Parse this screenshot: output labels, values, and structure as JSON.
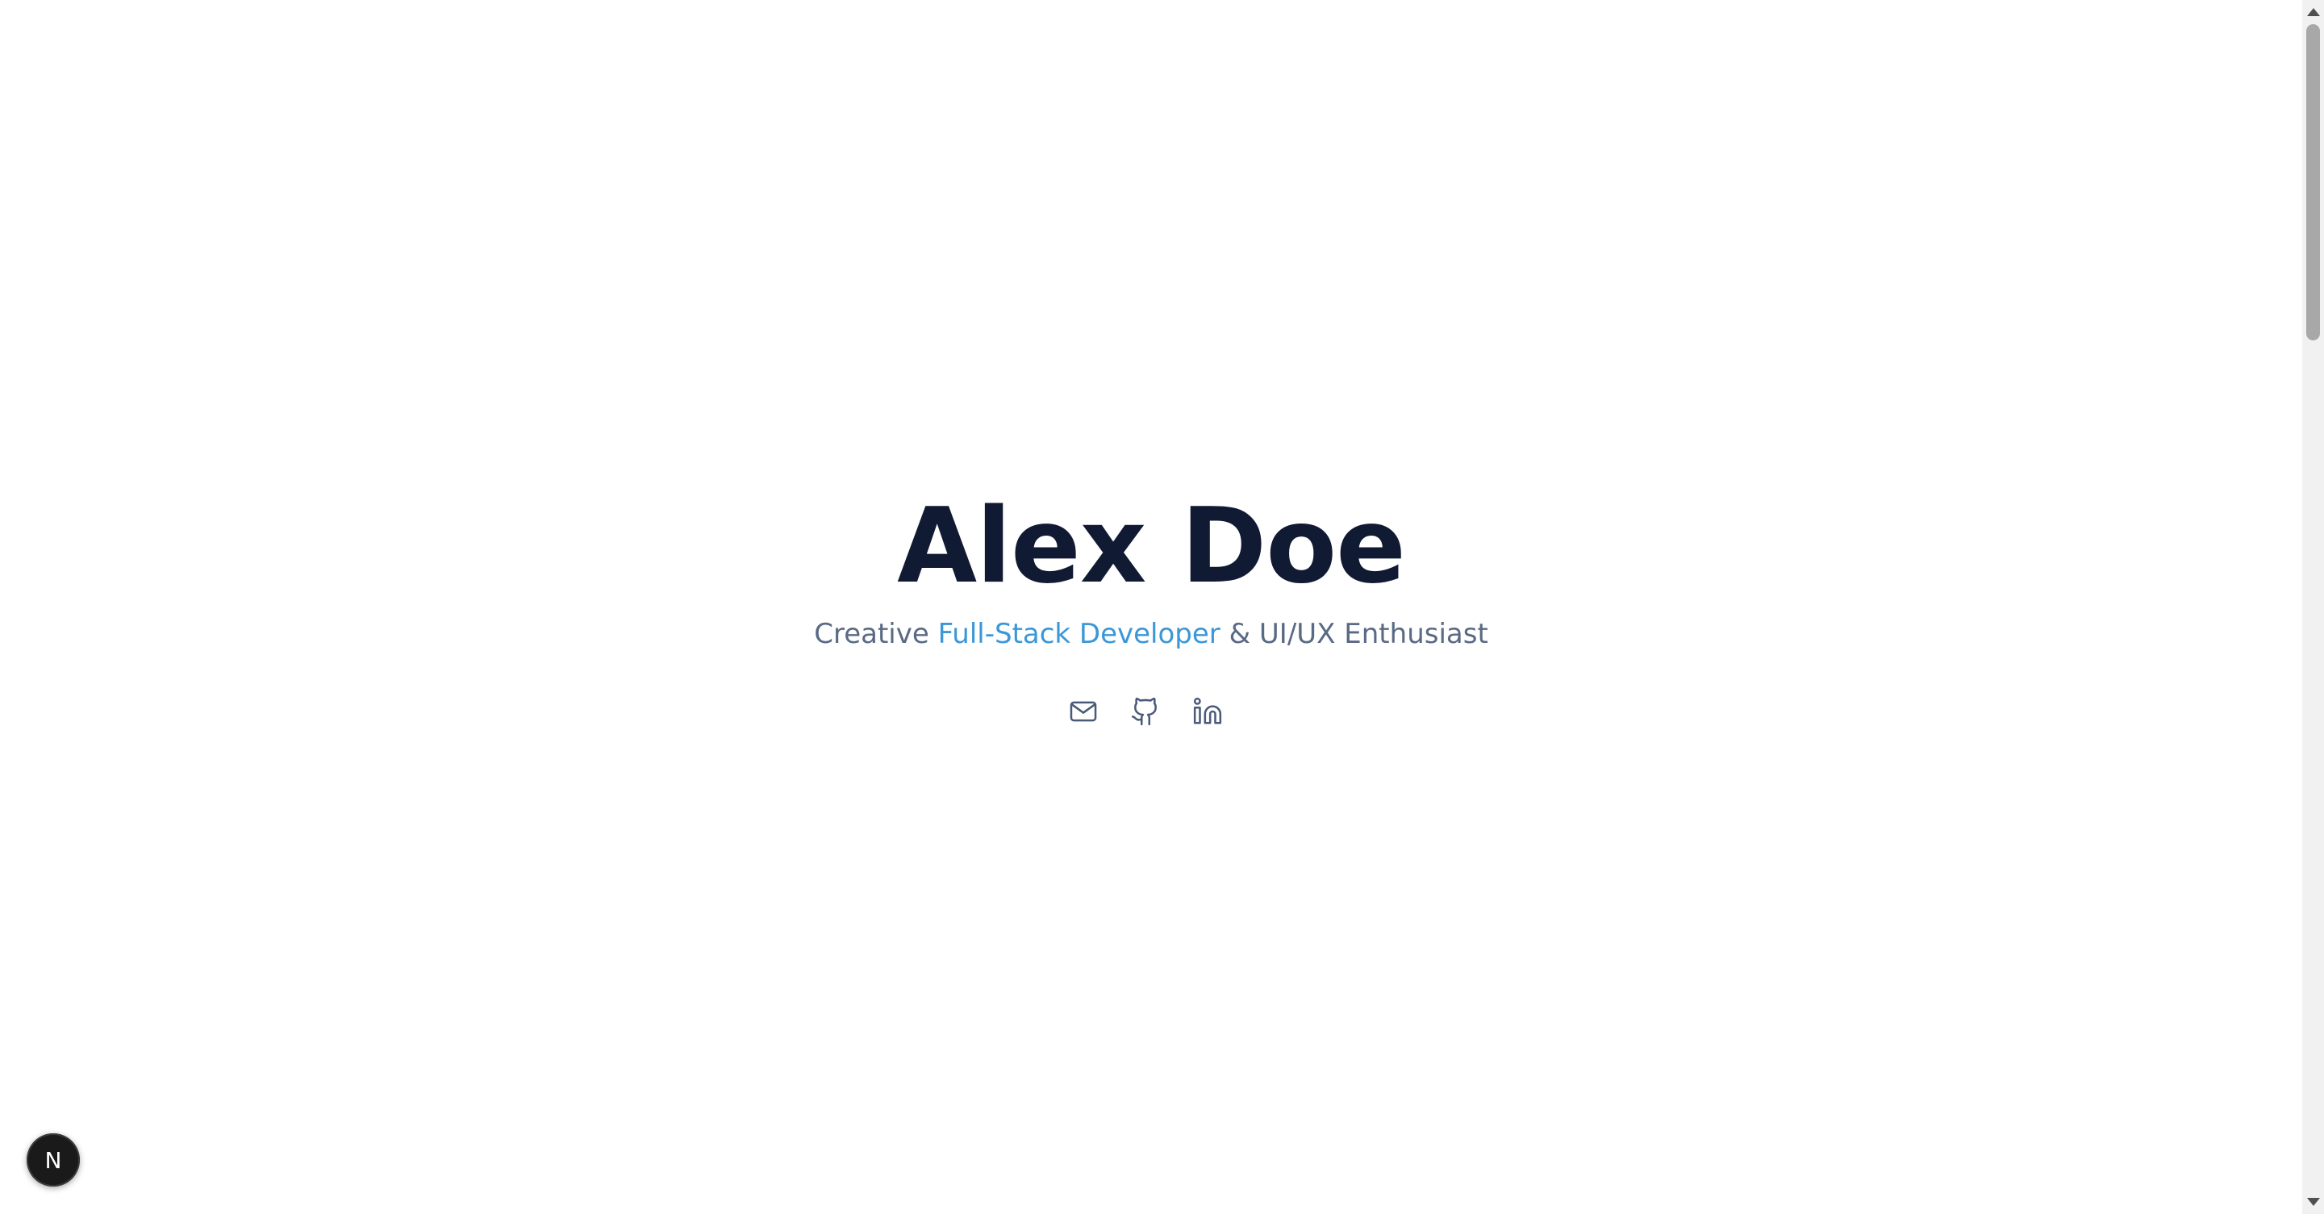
{
  "hero": {
    "name": "Alex Doe",
    "tagline_prefix": "Creative ",
    "tagline_accent": "Full-Stack Developer",
    "tagline_suffix": " & UI/UX Enthusiast"
  },
  "socials": [
    {
      "icon": "mail-icon",
      "label": "Email"
    },
    {
      "icon": "github-icon",
      "label": "GitHub"
    },
    {
      "icon": "linkedin-icon",
      "label": "LinkedIn"
    }
  ],
  "dev_badge": {
    "label": "N",
    "icon": "nextjs-dev-indicator"
  },
  "colors": {
    "heading": "#111a33",
    "text": "#5a6a84",
    "accent": "#3b97d8",
    "icon": "#4a5a78",
    "background": "#ffffff"
  }
}
